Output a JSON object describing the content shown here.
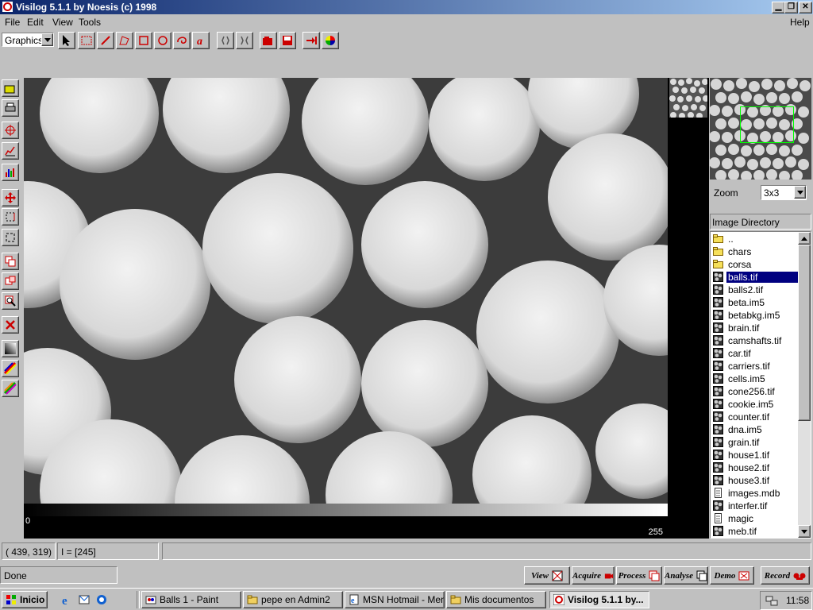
{
  "window": {
    "title": "Visilog 5.1.1 by Noesis (c) 1998",
    "controls": [
      "minimize-icon",
      "maximize-icon",
      "close-icon"
    ]
  },
  "menu": {
    "file": "File",
    "edit": "Edit",
    "view": "View",
    "tools": "Tools",
    "help": "Help"
  },
  "toolbar": {
    "mode_select": "Graphics",
    "tools": [
      "arrow-icon",
      "rectangle-select-icon",
      "pencil-icon",
      "polygon-icon",
      "square-icon",
      "circle-icon",
      "lasso-icon",
      "text-icon",
      "bracket-icon",
      "bracket-expand-icon",
      "open-folder-icon",
      "save-icon",
      "arrow-in-icon",
      "color-wheel-icon"
    ]
  },
  "left_tools": [
    "open-icon",
    "print-icon",
    "crosshair-icon",
    "profile-icon",
    "histogram-icon",
    "move-icon",
    "roi-icon",
    "frame-icon",
    "copy-icon",
    "paste-icon",
    "zoom-icon",
    "delete-icon",
    "gradient-icon",
    "palette-icon",
    "lut-icon"
  ],
  "image": {
    "file": "balls.tif",
    "gray_min": "0",
    "gray_max": "255"
  },
  "navigator": {
    "zoom_label": "Zoom",
    "zoom_value": "3x3"
  },
  "directory": {
    "header": "Image Directory",
    "selected": "balls.tif",
    "items": [
      {
        "name": "..",
        "type": "folder"
      },
      {
        "name": "chars",
        "type": "folder"
      },
      {
        "name": "corsa",
        "type": "folder"
      },
      {
        "name": "balls.tif",
        "type": "image"
      },
      {
        "name": "balls2.tif",
        "type": "image"
      },
      {
        "name": "beta.im5",
        "type": "image"
      },
      {
        "name": "betabkg.im5",
        "type": "image"
      },
      {
        "name": "brain.tif",
        "type": "image"
      },
      {
        "name": "camshafts.tif",
        "type": "image"
      },
      {
        "name": "car.tif",
        "type": "image"
      },
      {
        "name": "carriers.tif",
        "type": "image"
      },
      {
        "name": "cells.im5",
        "type": "image"
      },
      {
        "name": "cone256.tif",
        "type": "image"
      },
      {
        "name": "cookie.im5",
        "type": "image"
      },
      {
        "name": "counter.tif",
        "type": "image"
      },
      {
        "name": "dna.im5",
        "type": "image"
      },
      {
        "name": "grain.tif",
        "type": "image"
      },
      {
        "name": "house1.tif",
        "type": "image"
      },
      {
        "name": "house2.tif",
        "type": "image"
      },
      {
        "name": "house3.tif",
        "type": "image"
      },
      {
        "name": "images.mdb",
        "type": "doc"
      },
      {
        "name": "interfer.tif",
        "type": "image"
      },
      {
        "name": "magic",
        "type": "doc"
      },
      {
        "name": "meb.tif",
        "type": "image"
      }
    ]
  },
  "status": {
    "coords": "( 439, 319)",
    "intensity": "I = [245]",
    "message": "Done"
  },
  "ribbon": [
    {
      "label": "View",
      "icon": "view-icon"
    },
    {
      "label": "Acquire",
      "icon": "camera-icon"
    },
    {
      "label": "Process",
      "icon": "process-icon"
    },
    {
      "label": "Analyse",
      "icon": "analyse-icon"
    },
    {
      "label": "Demo",
      "icon": "demo-icon"
    },
    {
      "label": "Record",
      "icon": "record-icon"
    }
  ],
  "taskbar": {
    "start": "Inicio",
    "quick_launch": [
      "ie-icon",
      "outlook-icon",
      "channels-icon"
    ],
    "tasks": [
      {
        "label": "Balls 1 - Paint",
        "icon": "paint-icon",
        "active": false
      },
      {
        "label": "pepe en Admin2",
        "icon": "folder-icon",
        "active": false
      },
      {
        "label": "MSN Hotmail - Men...",
        "icon": "ie-page-icon",
        "active": false
      },
      {
        "label": "Mis documentos",
        "icon": "folder-icon",
        "active": false
      },
      {
        "label": "Visilog 5.1.1 by...",
        "icon": "visilog-icon",
        "active": true
      }
    ],
    "clock": "11:58"
  },
  "colors": {
    "title_start": "#0a246a",
    "title_end": "#a6caf0",
    "selection": "#000080",
    "navrect": "#00ff00",
    "face": "#c0c0c0"
  }
}
